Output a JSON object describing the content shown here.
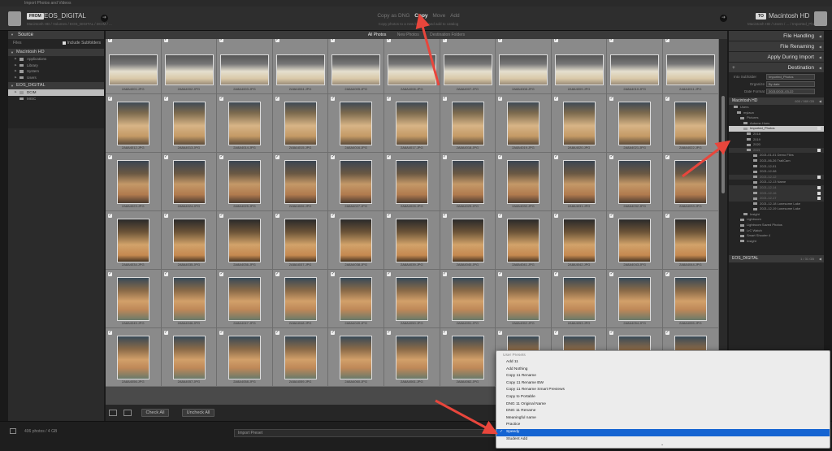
{
  "window": {
    "title": "Import Photos and Videos"
  },
  "source": {
    "from_badge": "FROM",
    "name": "EOS_DIGITAL",
    "path": "Macintosh HD / Volumes / EOS_DIGITAL / DCIM / ..."
  },
  "modes": {
    "items": [
      {
        "label": "Copy as DNG",
        "active": false
      },
      {
        "label": "Copy",
        "active": true
      },
      {
        "label": "Move",
        "active": false
      },
      {
        "label": "Add",
        "active": false
      }
    ],
    "subtitle": "Copy photos to a new location and add to catalog"
  },
  "destination_hdr": {
    "to_badge": "TO",
    "name": "Macintosh HD",
    "path": "Macintosh HD / Users / ... / Imported_Photos"
  },
  "left_panel": {
    "title": "Source",
    "files_label": "Files",
    "include_subfolders": "Include Subfolders",
    "macintosh_hd": "Macintosh HD",
    "mac_items": [
      "Applications",
      "Library",
      "System",
      "Users"
    ],
    "eos_digital": "EOS_DIGITAL",
    "eos_items": [
      "DCIM",
      "MISC"
    ]
  },
  "grid_header": {
    "tabs": [
      {
        "label": "All Photos",
        "active": true
      },
      {
        "label": "New Photos",
        "active": false
      },
      {
        "label": "Destination Folders",
        "active": false
      }
    ]
  },
  "grid": {
    "rows": [
      {
        "type": "land",
        "tone": "t1",
        "files": [
          "2A8A4001.JPG",
          "2A8A4002.JPG",
          "2A8A4003.JPG",
          "2A8A4004.JPG",
          "2A8A4005.JPG",
          "2A8A4006.JPG",
          "2A8A4007.JPG",
          "2A8A4008.JPG",
          "2A8A4009.JPG",
          "2A8A4010.JPG",
          "2A8A4011.JPG"
        ]
      },
      {
        "type": "port",
        "tone": "t2",
        "files": [
          "2A8A4012.JPG",
          "2A8A4013.JPG",
          "2A8A4014.JPG",
          "2A8A4015.JPG",
          "2A8A4016.JPG",
          "2A8A4017.JPG",
          "2A8A4018.JPG",
          "2A8A4019.JPG",
          "2A8A4020.JPG",
          "2A8A4021.JPG",
          "2A8A4022.JPG"
        ]
      },
      {
        "type": "port",
        "tone": "t3",
        "files": [
          "2A8A4023.JPG",
          "2A8A4024.JPG",
          "2A8A4025.JPG",
          "2A8A4026.JPG",
          "2A8A4027.JPG",
          "2A8A4028.JPG",
          "2A8A4029.JPG",
          "2A8A4030.JPG",
          "2A8A4031.JPG",
          "2A8A4032.JPG",
          "2A8A4033.JPG"
        ]
      },
      {
        "type": "port",
        "tone": "t4",
        "files": [
          "2A8A4034.JPG",
          "2A8A4035.JPG",
          "2A8A4036.JPG",
          "2A8A4037.JPG",
          "2A8A4038.JPG",
          "2A8A4039.JPG",
          "2A8A4040.JPG",
          "2A8A4041.JPG",
          "2A8A4042.JPG",
          "2A8A4043.JPG",
          "2A8A4044.JPG"
        ]
      },
      {
        "type": "port",
        "tone": "t5",
        "files": [
          "2A8A4045.JPG",
          "2A8A4046.JPG",
          "2A8A4047.JPG",
          "2A8A4048.JPG",
          "2A8A4049.JPG",
          "2A8A4050.JPG",
          "2A8A4051.JPG",
          "2A8A4052.JPG",
          "2A8A4053.JPG",
          "2A8A4054.JPG",
          "2A8A4055.JPG"
        ]
      },
      {
        "type": "port",
        "tone": "t6",
        "files": [
          "2A8A4056.JPG",
          "2A8A4057.JPG",
          "2A8A4058.JPG",
          "2A8A4059.JPG",
          "2A8A4060.JPG",
          "2A8A4061.JPG",
          "2A8A4062.JPG",
          "2A8A4063.JPG",
          "2A8A4064.JPG",
          "2A8A4065.JPG",
          "2A8A4066.JPG"
        ]
      }
    ]
  },
  "toolbar": {
    "check_all": "Check All",
    "uncheck_all": "Uncheck All"
  },
  "right_panel": {
    "file_handling": "File Handling",
    "file_renaming": "File Renaming",
    "apply_during_import": "Apply During Import",
    "destination": "Destination",
    "into_subfolder_label": "Into Subfolder",
    "into_subfolder_value": "Imported_Photos",
    "organize_label": "Organize",
    "organize_value": "By date",
    "date_format_label": "Date Format",
    "date_format_value": "2021/2021-03-22",
    "volume_name": "Macintosh HD",
    "volume_stat": "600 / 989 GB",
    "tree": [
      {
        "label": "Users",
        "indent": 6,
        "state": ""
      },
      {
        "label": "mylaun",
        "indent": 10,
        "state": ""
      },
      {
        "label": "Pictures",
        "indent": 14,
        "state": ""
      },
      {
        "label": "Autumn Hues",
        "indent": 18,
        "state": ""
      },
      {
        "label": "Imported_Photos",
        "indent": 18,
        "state": "sel"
      },
      {
        "label": "2018",
        "indent": 22,
        "state": ""
      },
      {
        "label": "2019",
        "indent": 22,
        "state": ""
      },
      {
        "label": "2020",
        "indent": 22,
        "state": ""
      },
      {
        "label": "2021",
        "indent": 22,
        "state": "dim"
      },
      {
        "label": "2021-01-01 Demo Files",
        "indent": 30,
        "state": ""
      },
      {
        "label": "2021-06-26 TrailCam",
        "indent": 30,
        "state": ""
      },
      {
        "label": "2021-12-01",
        "indent": 30,
        "state": ""
      },
      {
        "label": "2021-12-08",
        "indent": 30,
        "state": ""
      },
      {
        "label": "2021-12-12",
        "indent": 30,
        "state": "dim"
      },
      {
        "label": "2021-12-13 Name",
        "indent": 30,
        "state": ""
      },
      {
        "label": "2021-12-14",
        "indent": 30,
        "state": "dim"
      },
      {
        "label": "2021-12-16",
        "indent": 30,
        "state": "dim"
      },
      {
        "label": "2021-12-17",
        "indent": 30,
        "state": "dim"
      },
      {
        "label": "2021-12-18 Lonesome Lake",
        "indent": 30,
        "state": ""
      },
      {
        "label": "2021-12-19 Lonesome Lake",
        "indent": 30,
        "state": ""
      },
      {
        "label": "Insight",
        "indent": 18,
        "state": ""
      },
      {
        "label": "Lightroom",
        "indent": 14,
        "state": ""
      },
      {
        "label": "Lightroom Saved Photos",
        "indent": 14,
        "state": ""
      },
      {
        "label": "LrC Watch",
        "indent": 14,
        "state": ""
      },
      {
        "label": "Smart Shooter 4",
        "indent": 14,
        "state": ""
      },
      {
        "label": "Insight",
        "indent": 14,
        "state": ""
      }
    ],
    "eos_volume": "EOS_DIGITAL",
    "eos_stat": "1 / 31 GB"
  },
  "status": {
    "count": "406 photos / 4 GB",
    "preset_label": "Import Preset"
  },
  "dropdown": {
    "group": "User Presets",
    "items": [
      {
        "label": "Add 11",
        "checked": false
      },
      {
        "label": "Add Nothing",
        "checked": false
      },
      {
        "label": "Copy 11 Rename",
        "checked": false
      },
      {
        "label": "Copy 11 Rename BW",
        "checked": false
      },
      {
        "label": "Copy 11 Rename Smart Previews",
        "checked": false
      },
      {
        "label": "Copy to Portable",
        "checked": false
      },
      {
        "label": "DNG 11 Original Name",
        "checked": false
      },
      {
        "label": "DNG 11 Rename",
        "checked": false
      },
      {
        "label": "Meaningful name",
        "checked": false
      },
      {
        "label": "Practice",
        "checked": false
      },
      {
        "label": "Speedy",
        "checked": true
      },
      {
        "label": "Student Add",
        "checked": false
      }
    ],
    "more_icon": "chevron-down-icon"
  },
  "colors": {
    "accent": "#1464d2",
    "annotation": "#e8463c"
  }
}
